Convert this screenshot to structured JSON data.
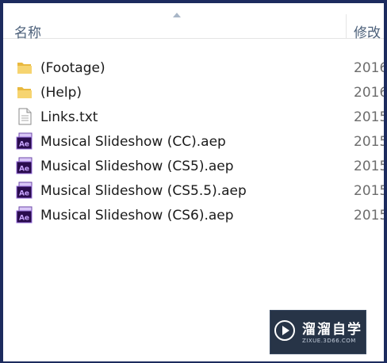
{
  "header": {
    "name_column": "名称",
    "modified_column": "修改"
  },
  "files": [
    {
      "name": "(Footage)",
      "date": "2016",
      "icon": "folder-icon"
    },
    {
      "name": "(Help)",
      "date": "2016",
      "icon": "folder-icon"
    },
    {
      "name": "Links.txt",
      "date": "2015",
      "icon": "text-file-icon"
    },
    {
      "name": "Musical Slideshow (CC).aep",
      "date": "2015",
      "icon": "after-effects-file-icon"
    },
    {
      "name": "Musical Slideshow (CS5).aep",
      "date": "2015",
      "icon": "after-effects-file-icon"
    },
    {
      "name": "Musical Slideshow (CS5.5).aep",
      "date": "2015",
      "icon": "after-effects-file-icon"
    },
    {
      "name": "Musical Slideshow (CS6).aep",
      "date": "2015",
      "icon": "after-effects-file-icon"
    }
  ],
  "watermark": {
    "title": "溜溜自学",
    "subtitle": "ZIXUE.3D66.COM"
  },
  "colors": {
    "frame": "#1c2b5e",
    "folder": "#f3cf62",
    "ae_purple": "#2a0c4e",
    "ae_text": "#c9a6ff"
  }
}
